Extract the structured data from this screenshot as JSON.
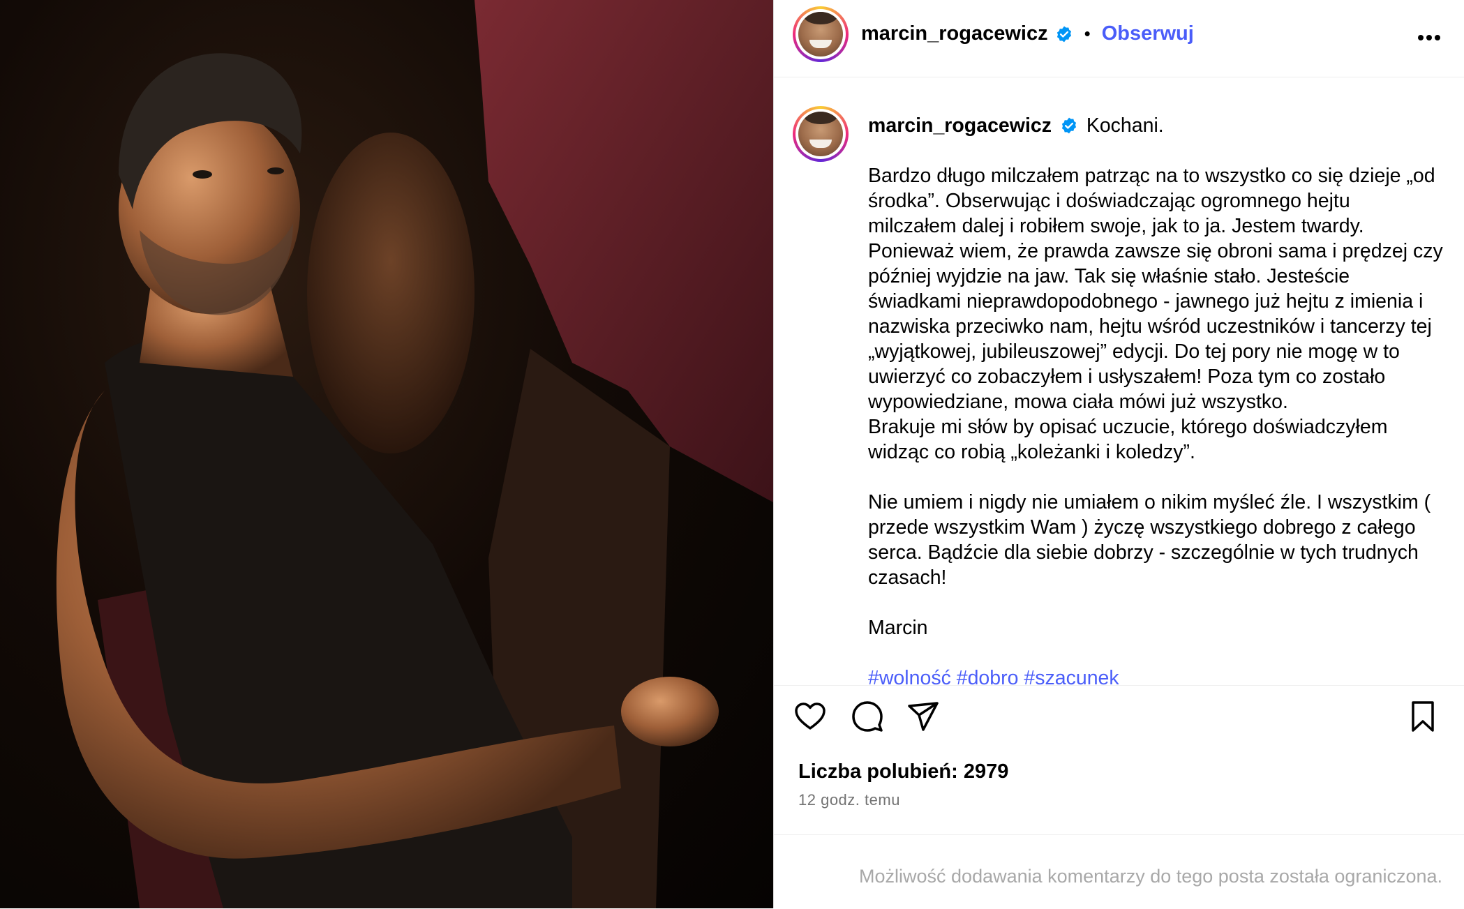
{
  "post": {
    "username": "marcin_rogacewicz",
    "follow_label": "Obserwuj",
    "separator": "•",
    "caption_greeting": "Kochani.",
    "caption_lines": [
      "Bardzo długo milczałem patrząc na to wszystko co się dzieje „od",
      "środka”. Obserwując i doświadczając ogromnego hejtu",
      "milczałem dalej i robiłem swoje, jak to ja. Jestem twardy.",
      "Ponieważ wiem, że prawda zawsze się obroni sama i prędzej czy",
      "później wyjdzie na jaw. Tak się właśnie stało. Jesteście",
      "świadkami nieprawdopodobnego - jawnego już hejtu z imienia i",
      "nazwiska przeciwko nam, hejtu wśród uczestników i tancerzy tej",
      "„wyjątkowej, jubileuszowej” edycji. Do tej pory nie mogę w to",
      "uwierzyć co zobaczyłem i usłyszałem! Poza tym co zostało",
      "wypowiedziane, mowa ciała mówi już wszystko.",
      "Brakuje mi słów by opisać uczucie, którego doświadczyłem",
      "widząc co robią „koleżanki i koledzy”."
    ],
    "caption_lines_2": [
      "Nie umiem i nigdy nie umiałem o nikim myśleć źle. I wszystkim (",
      "przede wszystkim Wam ) życzę wszystkiego dobrego z całego",
      "serca. Bądźcie dla siebie dobrzy - szczególnie w tych trudnych",
      "czasach!"
    ],
    "signature": "Marcin",
    "hashtags": "#wolność #dobro #szacunek",
    "likes_label": "Liczba polubień: 2979",
    "time_ago": "12 godz. temu",
    "comments_disabled": "Możliwość dodawania komentarzy do tego posta została ograniczona."
  },
  "icons": {
    "verified": "verified-badge-icon",
    "more": "more-options-icon",
    "like": "heart-icon",
    "comment": "comment-icon",
    "share": "share-icon",
    "save": "bookmark-icon"
  },
  "colors": {
    "link": "#4a5df9",
    "verified": "#0095f6",
    "muted": "#737373"
  }
}
